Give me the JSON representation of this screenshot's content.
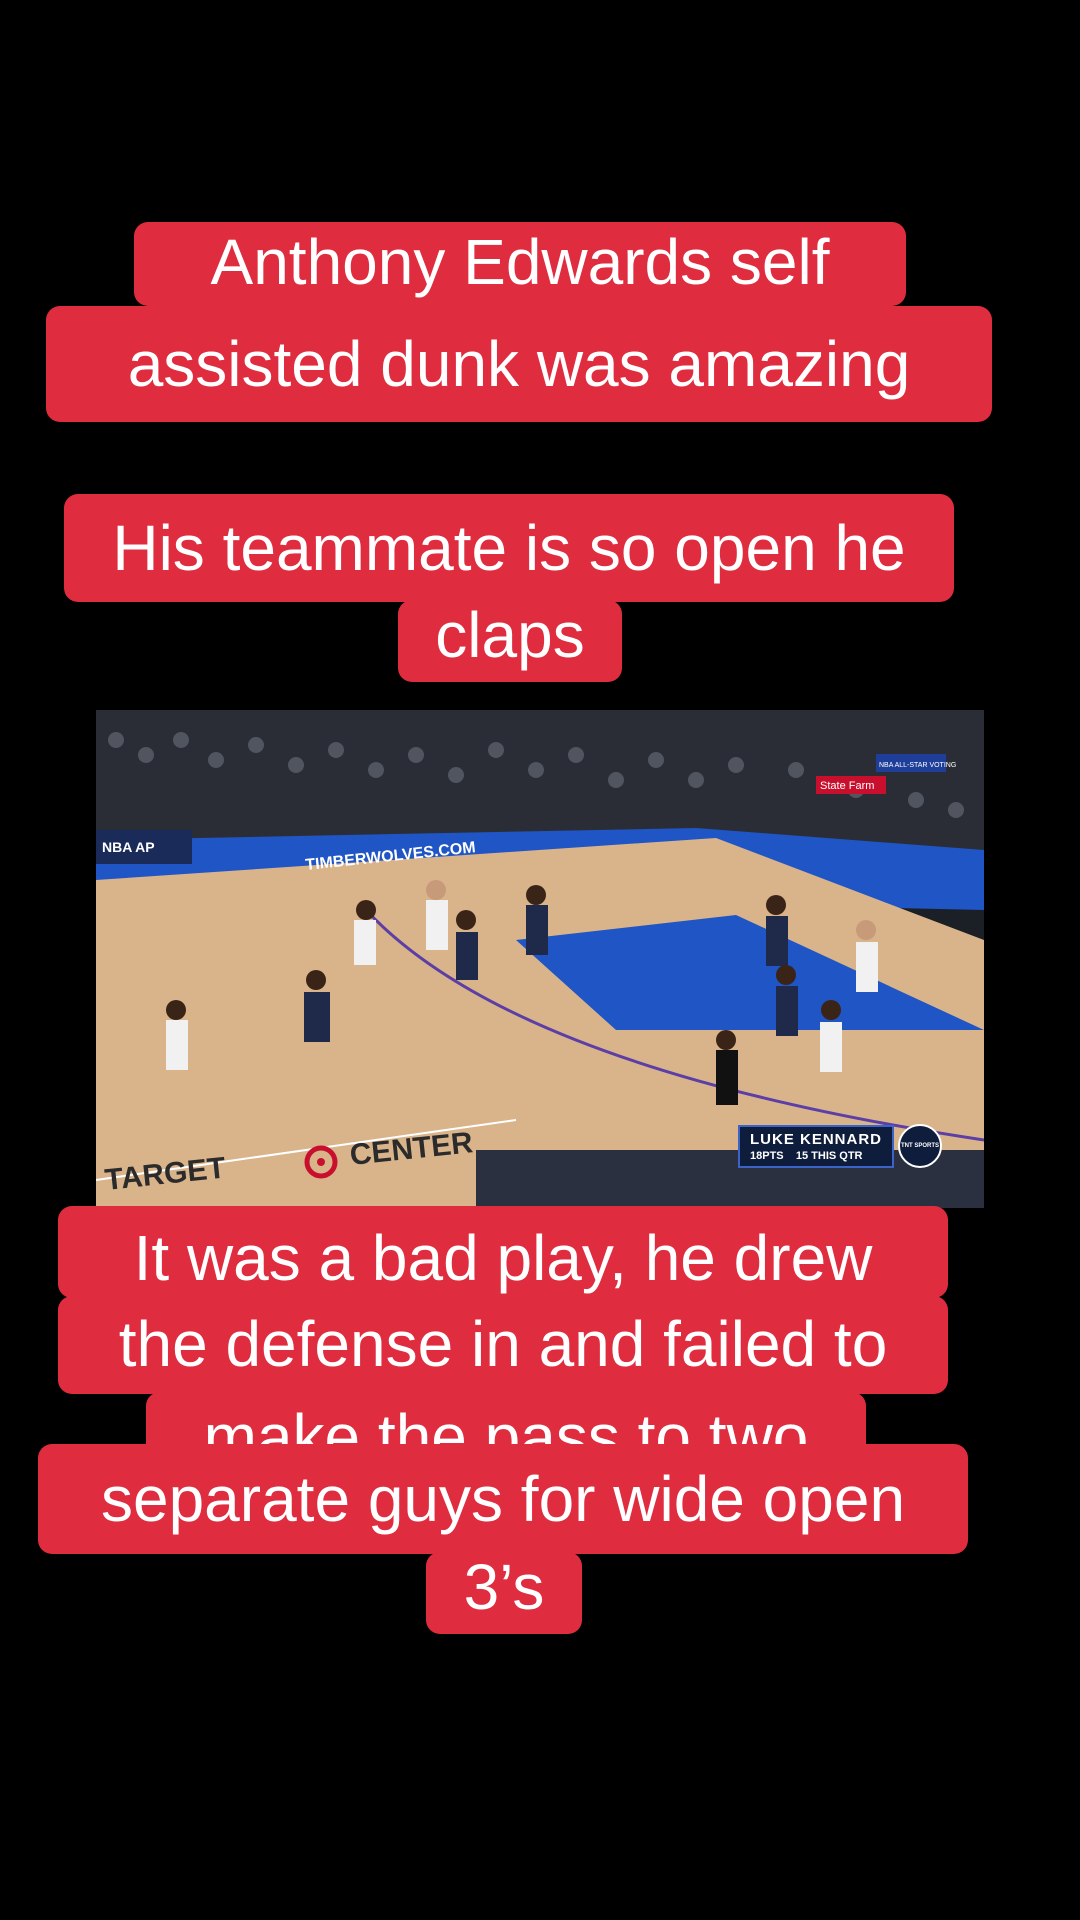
{
  "captions": {
    "top_line1": "Anthony Edwards self",
    "top_line2": "assisted dunk was amazing",
    "middle_line1": "His teammate is so open he",
    "middle_line2": "claps",
    "bottom_line1": "It was  a bad play, he drew",
    "bottom_line2": "the defense in and failed to",
    "bottom_line3": "make the pass to two",
    "bottom_line4": "separate guys for wide open",
    "bottom_line5": "3’s"
  },
  "video": {
    "court_text_baseline": "TIMBERWOLVES.COM",
    "court_text_sponsor_left": "TARGET",
    "court_text_sponsor_right": "CENTER",
    "banner_left": "NBA AP",
    "banner_right": "State Farm",
    "banner_top_right": "NBA ALL-STAR VOTING",
    "scorebug": {
      "player": "LUKE KENNARD",
      "points": "18PTS",
      "quarter": "15 THIS QTR"
    },
    "network_logo": "TNT SPORTS"
  },
  "colors": {
    "caption_bg": "#df2c3e",
    "caption_text": "#ffffff",
    "court_wood": "#d9b48a",
    "paint_blue": "#1f55c4"
  }
}
